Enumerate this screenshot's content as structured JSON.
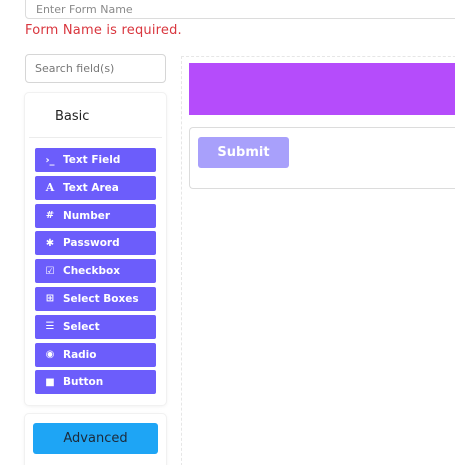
{
  "form_name": {
    "placeholder": "Enter Form Name",
    "value": "",
    "error": "Form Name is required."
  },
  "search": {
    "placeholder": "Search field(s)",
    "value": ""
  },
  "sidebar": {
    "group_title": "Basic",
    "items": [
      {
        "label": "Text Field",
        "icon": "terminal-icon",
        "glyph": "›_"
      },
      {
        "label": "Text Area",
        "icon": "font-icon",
        "glyph": "A"
      },
      {
        "label": "Number",
        "icon": "hashtag-icon",
        "glyph": "#"
      },
      {
        "label": "Password",
        "icon": "asterisk-icon",
        "glyph": "✱"
      },
      {
        "label": "Checkbox",
        "icon": "check-square-icon",
        "glyph": "☑"
      },
      {
        "label": "Select Boxes",
        "icon": "plus-square-icon",
        "glyph": "⊞"
      },
      {
        "label": "Select",
        "icon": "list-icon",
        "glyph": "☰"
      },
      {
        "label": "Radio",
        "icon": "dot-circle-icon",
        "glyph": "◉"
      },
      {
        "label": "Button",
        "icon": "stop-icon",
        "glyph": "■"
      }
    ],
    "advanced_label": "Advanced"
  },
  "canvas": {
    "submit_label": "Submit"
  },
  "colors": {
    "component_button": "#6c5dfb",
    "advanced_button": "#1ea5f5",
    "header_bar": "#b54cfb",
    "submit_button": "#a8a0fb",
    "error": "#d9363e"
  }
}
